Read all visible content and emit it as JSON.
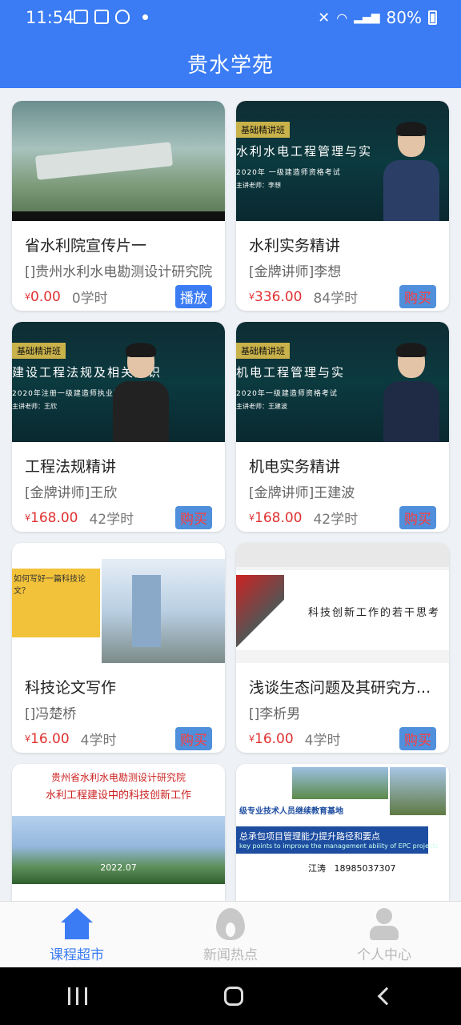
{
  "status_bar": {
    "time": "11:54",
    "battery": "80%"
  },
  "app": {
    "title": "贵水学苑"
  },
  "courses": [
    {
      "title": "省水利院宣传片一",
      "teacher": "[]贵州水利水电勘测设计研究院",
      "currency": "¥",
      "price": "0.00",
      "hours": "0学时",
      "action": "播放"
    },
    {
      "title": "水利实务精讲",
      "teacher": "[金牌讲师]李想",
      "currency": "¥",
      "price": "336.00",
      "hours": "84学时",
      "action": "购买",
      "thumb": {
        "badge": "基础精讲班",
        "heading": "水利水电工程管理与实",
        "sub": "2020年 一级建造师资格考试",
        "teacher": "主讲老师：李想"
      }
    },
    {
      "title": "工程法规精讲",
      "teacher": "[金牌讲师]王欣",
      "currency": "¥",
      "price": "168.00",
      "hours": "42学时",
      "action": "购买",
      "thumb": {
        "badge": "基础精讲班",
        "heading": "建设工程法规及相关知识",
        "sub": "2020年注册一级建造师执业资格考试",
        "teacher": "主讲老师：王欣"
      }
    },
    {
      "title": "机电实务精讲",
      "teacher": "[金牌讲师]王建波",
      "currency": "¥",
      "price": "168.00",
      "hours": "42学时",
      "action": "购买",
      "thumb": {
        "badge": "基础精讲班",
        "heading": "机电工程管理与实",
        "sub": "2020年一级建造师资格考试",
        "teacher": "主讲老师：王建波"
      }
    },
    {
      "title": "科技论文写作",
      "teacher": "[]冯楚桥",
      "currency": "¥",
      "price": "16.00",
      "hours": "4学时",
      "action": "购买",
      "thumb": {
        "text": "如何写好一篇科技论文？"
      }
    },
    {
      "title": "浅谈生态问题及其研究方...",
      "teacher": "[]李析男",
      "currency": "¥",
      "price": "16.00",
      "hours": "4学时",
      "action": "购买",
      "thumb": {
        "text": "科技创新工作的若干思考"
      }
    },
    {
      "thumb": {
        "org": "贵州省水利水电勘测设计研究院",
        "title": "水利工程建设中的科技创新工作",
        "year": "2022.07"
      }
    },
    {
      "thumb": {
        "base": "级专业技术人员继续教育基地",
        "heading": "总承包项目管理能力提升路径和要点",
        "sub": "key points to improve the management ability of EPC projects",
        "name": "江涛",
        "phone": "18985037307"
      }
    }
  ],
  "tabs": [
    {
      "label": "课程超市",
      "icon": "home-icon"
    },
    {
      "label": "新闻热点",
      "icon": "fire-icon"
    },
    {
      "label": "个人中心",
      "icon": "user-icon"
    }
  ],
  "colors": {
    "primary": "#3b7cf4",
    "price": "#e03030",
    "buy_text": "#ff3b3b"
  }
}
